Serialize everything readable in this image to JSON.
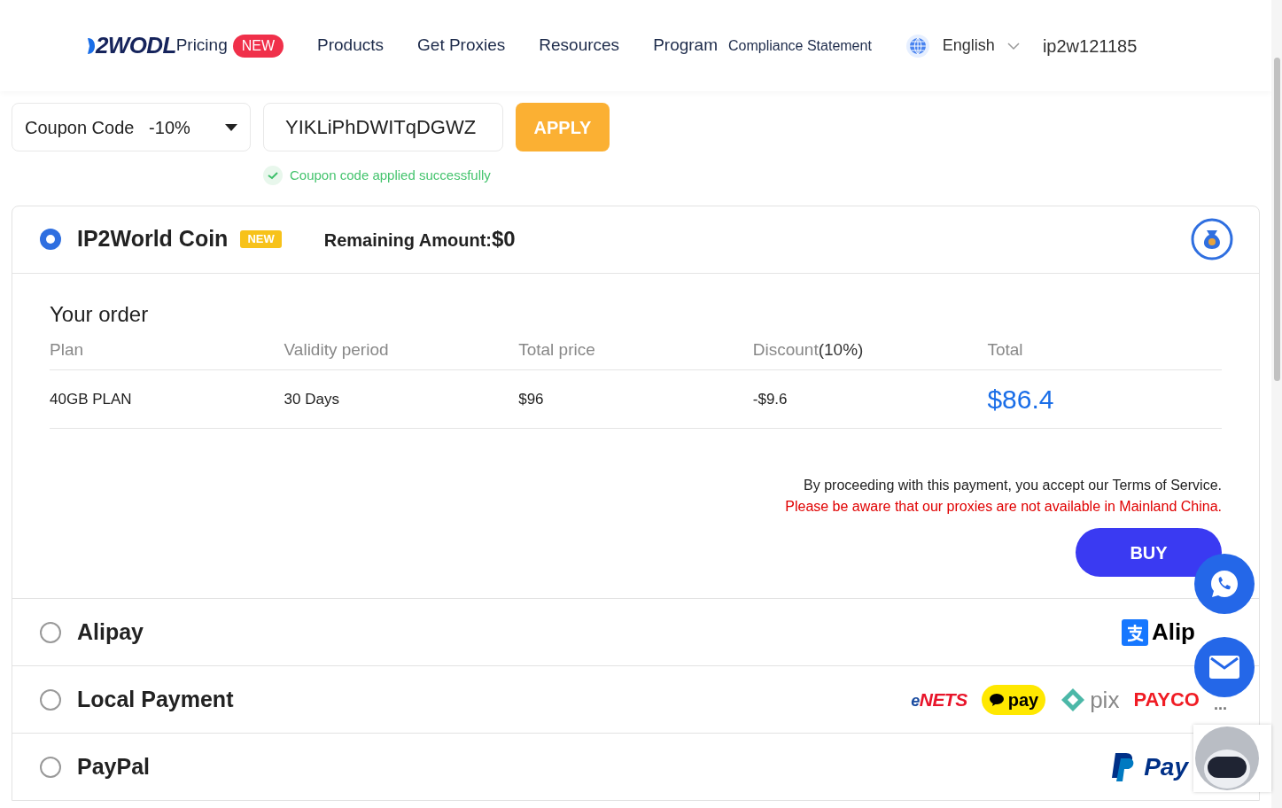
{
  "nav": {
    "logo": "2WODL",
    "items": [
      {
        "label": "Pricing",
        "badge": "NEW"
      },
      {
        "label": "Products"
      },
      {
        "label": "Get Proxies"
      },
      {
        "label": "Resources"
      },
      {
        "label": "Program"
      },
      {
        "label": "Compliance Statement",
        "small": true
      }
    ],
    "language": "English",
    "user": "ip2w121185"
  },
  "coupon": {
    "select": "Coupon Code",
    "discount": "-10%",
    "code": "YIKLiPhDWITqDGWZ",
    "apply": "APPLY",
    "message": "Coupon code applied successfully"
  },
  "methods": [
    {
      "name": "IP2World Coin",
      "selected": true,
      "badge": "NEW",
      "remaining_label": "Remaining Amount:",
      "remaining_value": "$0",
      "expanded": true,
      "logos": [
        {
          "kind": "moneybag"
        }
      ]
    },
    {
      "name": "Alipay",
      "selected": false,
      "expanded": false,
      "logos": [
        {
          "kind": "alipay",
          "text": "Alip"
        }
      ]
    },
    {
      "name": "Local Payment",
      "selected": false,
      "expanded": false,
      "logos": [
        {
          "kind": "enets",
          "text": "NETS",
          "prefix": "e"
        },
        {
          "kind": "kakaopay",
          "text": "pay"
        },
        {
          "kind": "pix",
          "text": "pix"
        },
        {
          "kind": "payco",
          "text": "PAYCO"
        },
        {
          "kind": "more",
          "text": "..."
        }
      ]
    },
    {
      "name": "PayPal",
      "selected": false,
      "expanded": false,
      "logos": [
        {
          "kind": "paypal",
          "text": "Pay"
        }
      ]
    }
  ],
  "order": {
    "title": "Your order",
    "columns": [
      {
        "label": "Plan"
      },
      {
        "label": "Validity period"
      },
      {
        "label": "Total price"
      },
      {
        "label": "Discount",
        "note": "(10%)"
      },
      {
        "label": "Total"
      }
    ],
    "row": [
      "40GB PLAN",
      "30 Days",
      "$96",
      "-$9.6",
      "$86.4"
    ],
    "terms": "By proceeding with this payment, you accept our Terms of Service.",
    "warning": "Please be aware that our proxies are not available in Mainland China.",
    "buy": "BUY"
  }
}
